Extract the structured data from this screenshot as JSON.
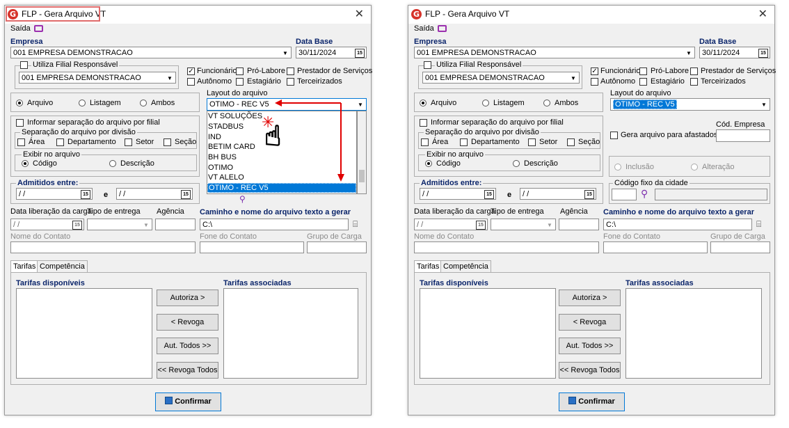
{
  "left": {
    "title": "FLP - Gera Arquivo VT",
    "saida": "Saída",
    "empresa_label": "Empresa",
    "empresa_value": "001 EMPRESA DEMONSTRACAO",
    "database_label": "Data Base",
    "database_value": "30/11/2024",
    "filial_label": "Utiliza Filial Responsável",
    "filial_value": "001 EMPRESA DEMONSTRACAO",
    "funcionario": "Funcionário",
    "prolabore": "Pró-Labore",
    "prestador": "Prestador de Serviços",
    "autonomo": "Autônomo",
    "estagiario": "Estagiário",
    "terceirizados": "Terceirizados",
    "arquivo": "Arquivo",
    "listagem": "Listagem",
    "ambos": "Ambos",
    "layout_label": "Layout do arquivo",
    "layout_value": "OTIMO - REC V5",
    "dropdown_items": [
      "VT SOLUÇÕES",
      "STADBUS",
      "IND",
      "BETIM CARD",
      "BH BUS",
      "OTIMO",
      "VT ALELO",
      "OTIMO - REC V5"
    ],
    "informar": "Informar separação do arquivo por filial",
    "separacao": "Separação do arquivo por divisão",
    "area": "Área",
    "departamento": "Departamento",
    "setor": "Setor",
    "secao": "Seção",
    "exibir": "Exibir no arquivo",
    "codigo": "Código",
    "descricao": "Descrição",
    "admitidos": "Admitidos entre:",
    "date_empty": "/ /",
    "e": "e",
    "data_lib": "Data liberação da carga",
    "tipo_entrega": "Tipo de entrega",
    "agencia": "Agência",
    "caminho": "Caminho e nome do arquivo texto a gerar",
    "caminho_value": "C:\\",
    "nome_contato": "Nome do Contato",
    "fone_contato": "Fone do Contato",
    "grupo_carga": "Grupo de Carga",
    "tab_tarifas": "Tarifas",
    "tab_competencia": "Competência",
    "tarifas_disp": "Tarifas disponíveis",
    "tarifas_assoc": "Tarifas associadas",
    "autoriza": "Autoriza >",
    "revoga": "< Revoga",
    "aut_todos": "Aut. Todos >>",
    "revoga_todos": "<< Revoga Todos",
    "confirmar": "Confirmar"
  },
  "right": {
    "title": "FLP - Gera Arquivo VT",
    "saida": "Saída",
    "empresa_label": "Empresa",
    "empresa_value": "001 EMPRESA DEMONSTRACAO",
    "database_label": "Data Base",
    "database_value": "30/11/2024",
    "filial_label": "Utiliza Filial Responsável",
    "filial_value": "001 EMPRESA DEMONSTRACAO",
    "funcionario": "Funcionário",
    "prolabore": "Pró-Labore",
    "prestador": "Prestador de Serviços",
    "autonomo": "Autônomo",
    "estagiario": "Estagiário",
    "terceirizados": "Terceirizados",
    "arquivo": "Arquivo",
    "listagem": "Listagem",
    "ambos": "Ambos",
    "layout_label": "Layout do arquivo",
    "layout_value": "OTIMO - REC V5",
    "informar": "Informar separação do arquivo por filial",
    "separacao": "Separação do arquivo por divisão",
    "area": "Área",
    "departamento": "Departamento",
    "setor": "Setor",
    "secao": "Seção",
    "exibir": "Exibir no arquivo",
    "codigo": "Código",
    "descricao": "Descrição",
    "gera_afastados": "Gera arquivo para afastados",
    "cod_empresa": "Cód. Empresa",
    "inclusao": "Inclusão",
    "alteracao": "Alteração",
    "admitidos": "Admitidos entre:",
    "date_empty": "/ /",
    "e": "e",
    "codigo_cidade": "Código fixo da cidade",
    "data_lib": "Data liberação da carga",
    "tipo_entrega": "Tipo de entrega",
    "agencia": "Agência",
    "caminho": "Caminho e nome do arquivo texto a gerar",
    "caminho_value": "C:\\",
    "nome_contato": "Nome do Contato",
    "fone_contato": "Fone do Contato",
    "grupo_carga": "Grupo de Carga",
    "tab_tarifas": "Tarifas",
    "tab_competencia": "Competência",
    "tarifas_disp": "Tarifas disponíveis",
    "tarifas_assoc": "Tarifas associadas",
    "autoriza": "Autoriza >",
    "revoga": "< Revoga",
    "aut_todos": "Aut. Todos >>",
    "revoga_todos": "<< Revoga Todos",
    "confirmar": "Confirmar"
  },
  "colors": {
    "accent": "#0078d7",
    "title_bold": "#0a246a",
    "annotation": "#e00000",
    "highlight_box": "#e06b6b"
  }
}
